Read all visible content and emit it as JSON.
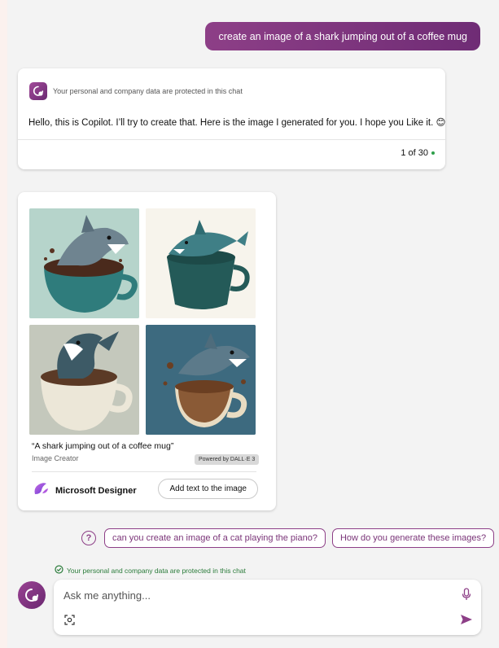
{
  "user_message": "create an image of a shark jumping out of a coffee mug",
  "reply": {
    "protection_note": "Your personal and company data are protected in this chat",
    "text": "Hello, this is Copilot. I’ll try to create that. Here is the image I generated for you. I hope you Like it. 😊",
    "counter": "1 of 30"
  },
  "image_card": {
    "caption": "“A shark jumping out of a coffee mug”",
    "creator": "Image Creator",
    "powered_by": "Powered by DALL·E 3",
    "designer_label": "Microsoft Designer",
    "add_text_button": "Add text to the image"
  },
  "suggestions": [
    "can you create an image of a cat playing the piano?",
    "How do you generate these images?"
  ],
  "composer": {
    "protection_note": "Your personal and company data are protected in this chat",
    "placeholder": "Ask me anything..."
  },
  "colors": {
    "accent": "#8d3f87",
    "protected_green": "#2a7b3a"
  },
  "icons": {
    "suggestion": "question-icon",
    "microphone": "microphone-icon",
    "scan": "visual-search-icon",
    "send": "send-icon"
  }
}
